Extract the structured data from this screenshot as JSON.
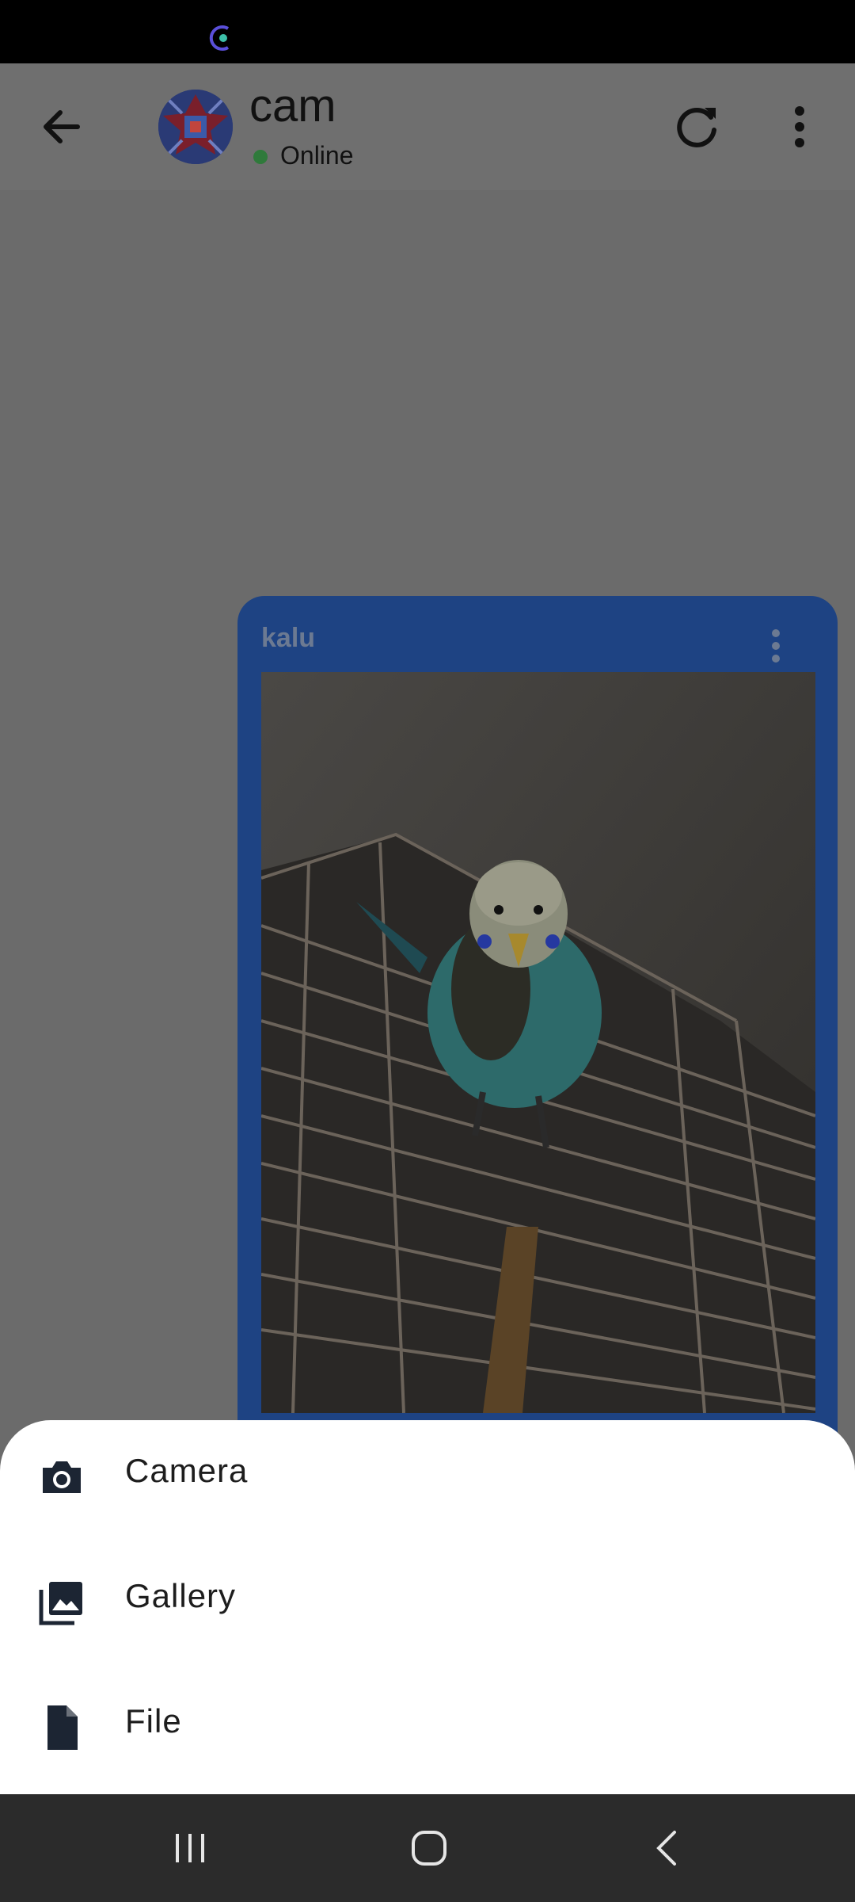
{
  "contact": {
    "name": "cam",
    "status": "Online",
    "status_color": "#2f7a3b"
  },
  "message": {
    "sender": "kalu",
    "bubble_color": "#1e4383"
  },
  "attachment_menu": {
    "items": [
      {
        "label": "Camera",
        "icon": "camera-icon"
      },
      {
        "label": "Gallery",
        "icon": "gallery-icon"
      },
      {
        "label": "File",
        "icon": "file-icon"
      }
    ]
  },
  "icons": {
    "back": "arrow-back-icon",
    "refresh": "refresh-icon",
    "overflow": "more-vert-icon",
    "nav_recents": "recents-icon",
    "nav_home": "home-icon",
    "nav_back": "nav-back-icon"
  }
}
